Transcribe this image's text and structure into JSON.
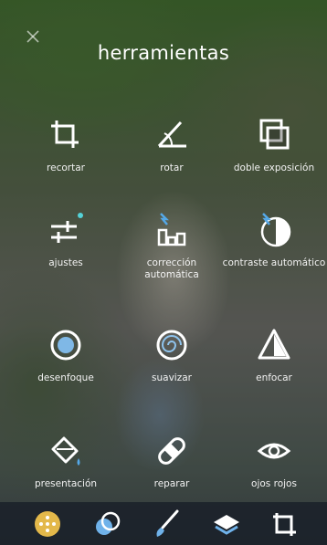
{
  "header": {
    "title": "herramientas",
    "close_icon": "close-icon"
  },
  "tools": [
    {
      "label": "recortar",
      "icon": "crop-icon"
    },
    {
      "label": "rotar",
      "icon": "rotate-icon"
    },
    {
      "label": "doble exposición",
      "icon": "double-exposure-icon"
    },
    {
      "label": "ajustes",
      "icon": "adjust-icon"
    },
    {
      "label": "corrección automática",
      "icon": "auto-fix-icon"
    },
    {
      "label": "contraste automático",
      "icon": "auto-contrast-icon"
    },
    {
      "label": "desenfoque",
      "icon": "blur-icon"
    },
    {
      "label": "suavizar",
      "icon": "smooth-icon"
    },
    {
      "label": "enfocar",
      "icon": "sharpen-icon"
    },
    {
      "label": "presentación",
      "icon": "paint-bucket-icon"
    },
    {
      "label": "reparar",
      "icon": "bandage-icon"
    },
    {
      "label": "ojos rojos",
      "icon": "eye-icon"
    }
  ],
  "bottom_bar": {
    "items": [
      "tools-icon",
      "effects-icon",
      "brush-icon",
      "layers-icon",
      "crop-frame-icon"
    ],
    "accent_color": "#e3b84a"
  }
}
